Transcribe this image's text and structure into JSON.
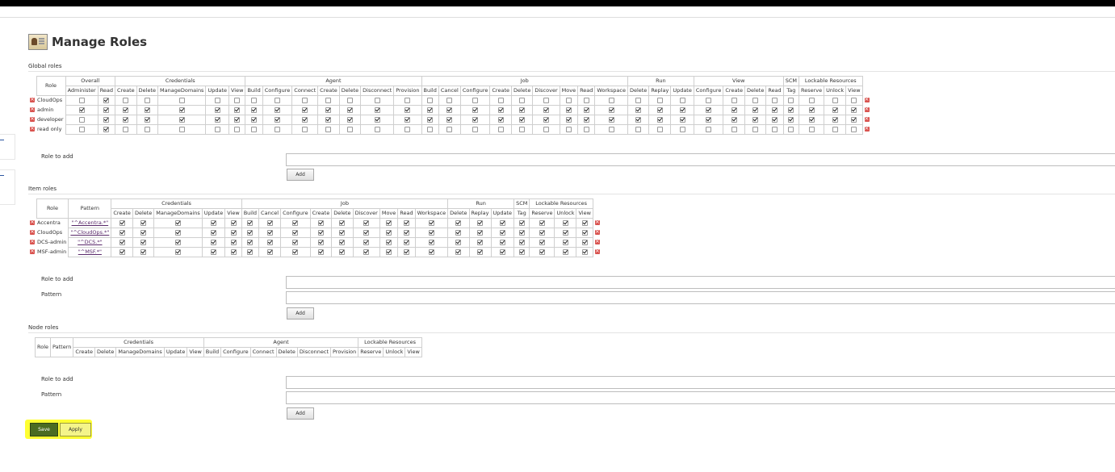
{
  "page": {
    "title": "Manage Roles"
  },
  "icons": {
    "header": "roles-icon",
    "delete": "delete-icon",
    "checkbox": "checkbox-icon"
  },
  "colors": {
    "save_bg": "#4b6c22",
    "apply_bg": "#f4f48a",
    "highlight": "#ffff33",
    "delete": "#d9534f"
  },
  "global": {
    "title": "Global roles",
    "role_header": "Role",
    "groups": [
      {
        "label": "Overall",
        "perms": [
          "Administer",
          "Read"
        ]
      },
      {
        "label": "Credentials",
        "perms": [
          "Create",
          "Delete",
          "ManageDomains",
          "Update",
          "View"
        ]
      },
      {
        "label": "Agent",
        "perms": [
          "Build",
          "Configure",
          "Connect",
          "Create",
          "Delete",
          "Disconnect",
          "Provision"
        ]
      },
      {
        "label": "Job",
        "perms": [
          "Build",
          "Cancel",
          "Configure",
          "Create",
          "Delete",
          "Discover",
          "Move",
          "Read",
          "Workspace"
        ]
      },
      {
        "label": "Run",
        "perms": [
          "Delete",
          "Replay",
          "Update"
        ]
      },
      {
        "label": "View",
        "perms": [
          "Configure",
          "Create",
          "Delete",
          "Read"
        ]
      },
      {
        "label": "SCM",
        "perms": [
          "Tag"
        ]
      },
      {
        "label": "Lockable Resources",
        "perms": [
          "Reserve",
          "Unlock",
          "View"
        ]
      }
    ],
    "rows": [
      {
        "name": "CloudOps",
        "checks": [
          0,
          1,
          0,
          0,
          0,
          0,
          0,
          0,
          0,
          0,
          0,
          0,
          0,
          0,
          0,
          0,
          0,
          0,
          0,
          0,
          0,
          0,
          0,
          0,
          0,
          0,
          0,
          0,
          0,
          0,
          0,
          0,
          0,
          0
        ]
      },
      {
        "name": "admin",
        "checks": [
          1,
          1,
          1,
          1,
          1,
          1,
          1,
          1,
          1,
          1,
          1,
          1,
          1,
          1,
          1,
          1,
          1,
          1,
          1,
          1,
          1,
          1,
          1,
          1,
          1,
          1,
          1,
          1,
          1,
          1,
          1,
          1,
          1,
          1
        ]
      },
      {
        "name": "developer",
        "checks": [
          0,
          1,
          1,
          1,
          1,
          1,
          1,
          1,
          1,
          1,
          1,
          1,
          1,
          1,
          1,
          1,
          1,
          1,
          1,
          1,
          1,
          1,
          1,
          1,
          1,
          1,
          1,
          1,
          1,
          1,
          1,
          1,
          1,
          1
        ]
      },
      {
        "name": "read only",
        "checks": [
          0,
          1,
          0,
          0,
          0,
          0,
          0,
          0,
          0,
          0,
          0,
          0,
          0,
          0,
          0,
          0,
          0,
          0,
          0,
          0,
          0,
          0,
          0,
          0,
          0,
          0,
          0,
          0,
          0,
          0,
          0,
          0,
          0,
          0
        ]
      }
    ],
    "role_to_add_label": "Role to add",
    "add_label": "Add"
  },
  "item": {
    "title": "Item roles",
    "role_header": "Role",
    "pattern_header": "Pattern",
    "groups": [
      {
        "label": "Credentials",
        "perms": [
          "Create",
          "Delete",
          "ManageDomains",
          "Update",
          "View"
        ]
      },
      {
        "label": "Job",
        "perms": [
          "Build",
          "Cancel",
          "Configure",
          "Create",
          "Delete",
          "Discover",
          "Move",
          "Read",
          "Workspace"
        ]
      },
      {
        "label": "Run",
        "perms": [
          "Delete",
          "Replay",
          "Update"
        ]
      },
      {
        "label": "SCM",
        "perms": [
          "Tag"
        ]
      },
      {
        "label": "Lockable Resources",
        "perms": [
          "Reserve",
          "Unlock",
          "View"
        ]
      }
    ],
    "rows": [
      {
        "name": "Accentra",
        "pattern": "\"^Accentra.*\"",
        "checks": [
          1,
          1,
          1,
          1,
          1,
          1,
          1,
          1,
          1,
          1,
          1,
          1,
          1,
          1,
          1,
          1,
          1,
          1,
          1,
          1,
          1
        ]
      },
      {
        "name": "CloudOps",
        "pattern": "\"^CloudOps.*\"",
        "checks": [
          1,
          1,
          1,
          1,
          1,
          1,
          1,
          1,
          1,
          1,
          1,
          1,
          1,
          1,
          1,
          1,
          1,
          1,
          1,
          1,
          1
        ]
      },
      {
        "name": "DCS-admin",
        "pattern": "\"^DCS.*\"",
        "checks": [
          1,
          1,
          1,
          1,
          1,
          1,
          1,
          1,
          1,
          1,
          1,
          1,
          1,
          1,
          1,
          1,
          1,
          1,
          1,
          1,
          1
        ]
      },
      {
        "name": "MSF-admin",
        "pattern": "\"^MSF.*\"",
        "checks": [
          1,
          1,
          1,
          1,
          1,
          1,
          1,
          1,
          1,
          1,
          1,
          1,
          1,
          1,
          1,
          1,
          1,
          1,
          1,
          1,
          1
        ]
      }
    ],
    "role_to_add_label": "Role to add",
    "pattern_label": "Pattern",
    "add_label": "Add"
  },
  "node": {
    "title": "Node roles",
    "role_header": "Role",
    "pattern_header": "Pattern",
    "groups": [
      {
        "label": "Credentials",
        "perms": [
          "Create",
          "Delete",
          "ManageDomains",
          "Update",
          "View"
        ]
      },
      {
        "label": "Agent",
        "perms": [
          "Build",
          "Configure",
          "Connect",
          "Delete",
          "Disconnect",
          "Provision"
        ]
      },
      {
        "label": "Lockable Resources",
        "perms": [
          "Reserve",
          "Unlock",
          "View"
        ]
      }
    ],
    "role_to_add_label": "Role to add",
    "pattern_label": "Pattern",
    "add_label": "Add"
  },
  "actions": {
    "save_label": "Save",
    "apply_label": "Apply"
  }
}
